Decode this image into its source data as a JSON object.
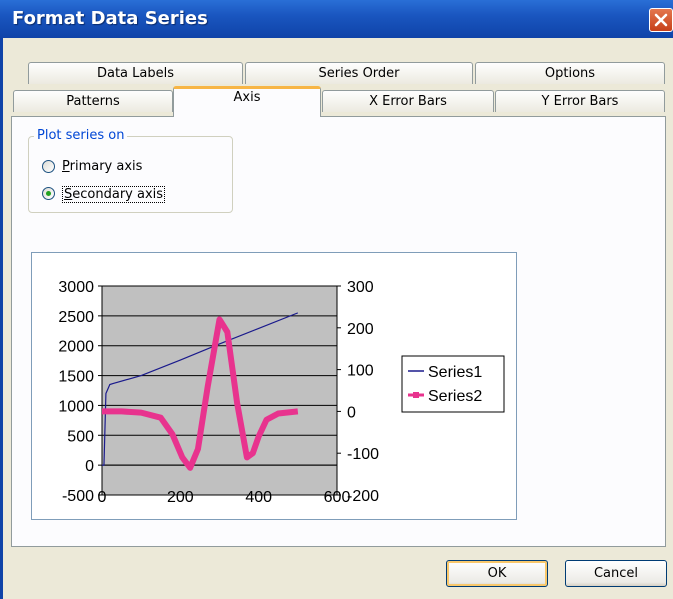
{
  "window": {
    "title": "Format Data Series"
  },
  "tabs": {
    "row1": [
      "Data Labels",
      "Series Order",
      "Options"
    ],
    "row2": [
      "Patterns",
      "Axis",
      "X Error Bars",
      "Y Error Bars"
    ],
    "active": "Axis"
  },
  "plot_series_on": {
    "label": "Plot series on",
    "options": [
      {
        "label": "Primary axis",
        "accelerator": "P",
        "selected": false
      },
      {
        "label": "Secondary axis",
        "accelerator": "S",
        "selected": true
      }
    ]
  },
  "buttons": {
    "ok": "OK",
    "cancel": "Cancel"
  },
  "colors": {
    "series1": "#1a1a8c",
    "series2": "#e8338e",
    "plot_area": "#c0c0c0",
    "title_bar": "#0f43a8",
    "active_tab_accent": "#f7b545"
  },
  "chart_data": {
    "type": "line",
    "grid": true,
    "legend": "right",
    "x_ticks": [
      "0",
      "200",
      "400",
      "600"
    ],
    "y_ticks_primary": [
      "3000",
      "2500",
      "2000",
      "1500",
      "1000",
      "500",
      "0",
      "-500"
    ],
    "y_ticks_secondary": [
      "300",
      "200",
      "100",
      "0",
      "-100",
      "-200"
    ],
    "xlim": [
      0,
      600
    ],
    "ylim_primary": [
      -500,
      3000
    ],
    "ylim_secondary": [
      -200,
      300
    ],
    "series": [
      {
        "name": "Series1",
        "axis": "primary",
        "x": [
          0,
          5,
          10,
          20,
          30,
          100,
          200,
          300,
          400,
          500
        ],
        "y": [
          0,
          0,
          1200,
          1350,
          1370,
          1500,
          1760,
          2030,
          2290,
          2550
        ]
      },
      {
        "name": "Series2",
        "axis": "secondary",
        "x": [
          0,
          50,
          100,
          150,
          180,
          205,
          225,
          245,
          270,
          300,
          320,
          345,
          370,
          385,
          400,
          420,
          450,
          500
        ],
        "y": [
          0,
          0,
          -3,
          -15,
          -55,
          -110,
          -135,
          -90,
          60,
          220,
          190,
          20,
          -110,
          -100,
          -60,
          -20,
          -5,
          0
        ]
      }
    ]
  }
}
